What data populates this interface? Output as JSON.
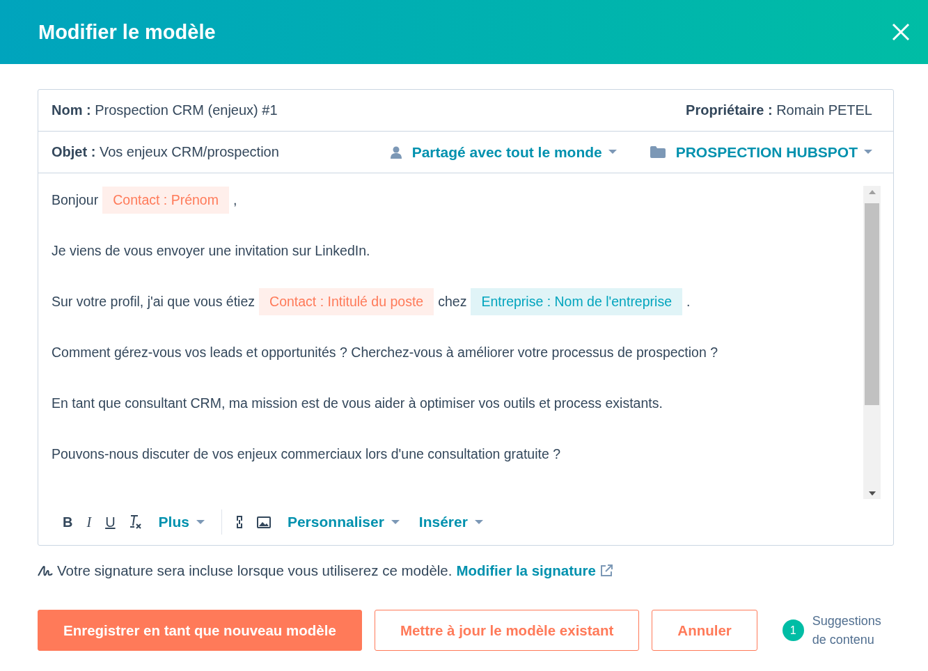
{
  "window": {
    "title": "Modifier le modèle"
  },
  "fields": {
    "name_label": "Nom :",
    "name_value": "Prospection CRM (enjeux) #1",
    "owner_label": "Propriétaire :",
    "owner_value": "Romain PETEL",
    "subject_label": "Objet :",
    "subject_value": "Vos enjeux CRM/prospection",
    "sharing": "Partagé avec tout le monde",
    "folder": "PROSPECTION HUBSPOT"
  },
  "body": [
    [
      {
        "kind": "text",
        "text": "Bonjour"
      },
      {
        "kind": "token",
        "text": "Contact : Prénom",
        "color": "#ff7a59"
      },
      {
        "kind": "text",
        "text": ","
      }
    ],
    [
      {
        "kind": "text",
        "text": "Je viens de vous envoyer une invitation sur LinkedIn."
      }
    ],
    [
      {
        "kind": "text",
        "text": "Sur votre profil, j'ai que vous étiez"
      },
      {
        "kind": "token",
        "text": "Contact : Intitulé du poste",
        "color": "#ff7a59"
      },
      {
        "kind": "text",
        "text": "chez"
      },
      {
        "kind": "token",
        "text": "Entreprise : Nom de l'entreprise",
        "color": "#00a4bd"
      },
      {
        "kind": "text",
        "text": "."
      }
    ],
    [
      {
        "kind": "text",
        "text": "Comment gérez-vous vos leads et opportunités ? Cherchez-vous à améliorer votre processus de prospection ?"
      }
    ],
    [
      {
        "kind": "text",
        "text": "En tant que consultant CRM, ma mission est de vous aider à optimiser vos outils et process existants."
      }
    ],
    [
      {
        "kind": "text",
        "text": "Pouvons-nous discuter de vos enjeux commerciaux lors d'une consultation gratuite ?"
      }
    ]
  ],
  "toolbar": [
    {
      "kind": "bold",
      "label": "B"
    },
    {
      "kind": "italic",
      "label": "I"
    },
    {
      "kind": "underline",
      "label": "U"
    },
    {
      "kind": "clear"
    },
    {
      "kind": "dropdown",
      "label": "Plus"
    },
    {
      "kind": "divider"
    },
    {
      "kind": "link"
    },
    {
      "kind": "image"
    },
    {
      "kind": "dropdown",
      "label": "Personnaliser"
    },
    {
      "kind": "dropdown",
      "label": "Insérer"
    }
  ],
  "signature": {
    "text": "Votre signature sera incluse lorsque vous utiliserez ce modèle.",
    "link": "Modifier la signature"
  },
  "buttons": [
    {
      "kind": "primary",
      "label": "Enregistrer en tant que nouveau modèle"
    },
    {
      "kind": "secondary",
      "label": "Mettre à jour le modèle existant"
    },
    {
      "kind": "secondary",
      "label": "Annuler"
    }
  ],
  "suggestions": {
    "count": "1",
    "label_line1": "Suggestions",
    "label_line2": "de contenu"
  }
}
